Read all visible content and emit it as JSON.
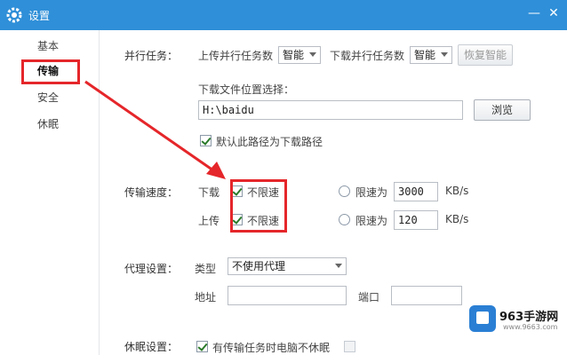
{
  "window": {
    "title": "设置",
    "minimize_glyph": "—",
    "close_glyph": "✕"
  },
  "sidebar": {
    "items": [
      {
        "label": "基本"
      },
      {
        "label": "传输"
      },
      {
        "label": "安全"
      },
      {
        "label": "休眠"
      }
    ]
  },
  "parallel": {
    "section_label": "并行任务：",
    "upload_label": "上传并行任务数",
    "upload_value": "智能",
    "download_label": "下载并行任务数",
    "download_value": "智能",
    "restore_button": "恢复智能"
  },
  "download_location": {
    "label": "下载文件位置选择：",
    "path_value": "H:\\baidu",
    "browse_button": "浏览",
    "default_checkbox_label": "默认此路径为下载路径",
    "default_checked": true
  },
  "speed": {
    "section_label": "传输速度：",
    "download_label": "下载",
    "upload_label": "上传",
    "unlimited_label": "不限速",
    "limit_label": "限速为",
    "download_limit_value": "3000",
    "upload_limit_value": "120",
    "unit": "KB/s",
    "download_unlimited_checked": true,
    "upload_unlimited_checked": true
  },
  "proxy": {
    "section_label": "代理设置：",
    "type_label": "类型",
    "type_value": "不使用代理",
    "address_label": "地址",
    "port_label": "端口"
  },
  "sleep": {
    "section_label": "休眠设置：",
    "checkbox_label": "有传输任务时电脑不休眠",
    "checked": true
  },
  "watermark": {
    "text": "963手游网",
    "url": "www.9663.com"
  },
  "colors": {
    "titlebar": "#2f8fd8",
    "highlight": "#e5262a"
  }
}
